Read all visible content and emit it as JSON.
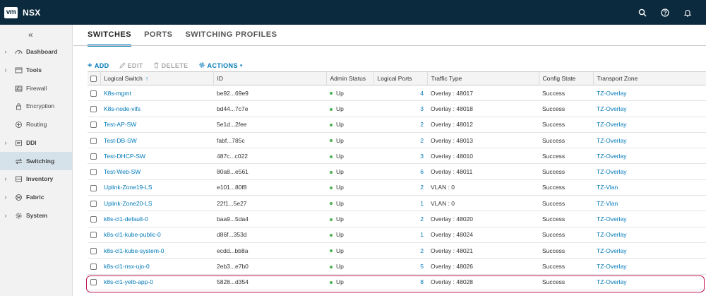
{
  "header": {
    "logo": "vm",
    "app_name": "NSX"
  },
  "sidebar": {
    "collapse_glyph": "«",
    "items": [
      {
        "label": "Dashboard",
        "icon": "dashboard-icon",
        "expandable": true
      },
      {
        "label": "Tools",
        "icon": "tools-icon",
        "expandable": true
      },
      {
        "label": "Firewall",
        "icon": "firewall-icon",
        "expandable": false
      },
      {
        "label": "Encryption",
        "icon": "lock-icon",
        "expandable": false
      },
      {
        "label": "Routing",
        "icon": "routing-icon",
        "expandable": false
      },
      {
        "label": "DDI",
        "icon": "ddi-icon",
        "expandable": true
      },
      {
        "label": "Switching",
        "icon": "switching-icon",
        "expandable": false
      },
      {
        "label": "Inventory",
        "icon": "inventory-icon",
        "expandable": true
      },
      {
        "label": "Fabric",
        "icon": "fabric-icon",
        "expandable": true
      },
      {
        "label": "System",
        "icon": "gear-icon",
        "expandable": true
      }
    ]
  },
  "tabs": [
    "SWITCHES",
    "PORTS",
    "SWITCHING PROFILES"
  ],
  "toolbar": {
    "add": "ADD",
    "edit": "EDIT",
    "delete": "DELETE",
    "actions": "ACTIONS"
  },
  "table": {
    "headers": [
      "Logical Switch",
      "ID",
      "Admin Status",
      "Logical Ports",
      "Traffic Type",
      "Config State",
      "Transport Zone"
    ],
    "rows": [
      {
        "name": "K8s-mgmt",
        "id": "be92...69e9",
        "status": "Up",
        "ports": "4",
        "traffic": "Overlay : 48017",
        "config": "Success",
        "zone": "TZ-Overlay"
      },
      {
        "name": "K8s-node-vifs",
        "id": "bd44...7c7e",
        "status": "Up",
        "ports": "3",
        "traffic": "Overlay : 48018",
        "config": "Success",
        "zone": "TZ-Overlay"
      },
      {
        "name": "Test-AP-SW",
        "id": "5e1d...2fee",
        "status": "Up",
        "ports": "2",
        "traffic": "Overlay : 48012",
        "config": "Success",
        "zone": "TZ-Overlay"
      },
      {
        "name": "Test-DB-SW",
        "id": "fabf...785c",
        "status": "Up",
        "ports": "2",
        "traffic": "Overlay : 48013",
        "config": "Success",
        "zone": "TZ-Overlay"
      },
      {
        "name": "Test-DHCP-SW",
        "id": "487c...c022",
        "status": "Up",
        "ports": "3",
        "traffic": "Overlay : 48010",
        "config": "Success",
        "zone": "TZ-Overlay"
      },
      {
        "name": "Test-Web-SW",
        "id": "80a8...e561",
        "status": "Up",
        "ports": "6",
        "traffic": "Overlay : 48011",
        "config": "Success",
        "zone": "TZ-Overlay"
      },
      {
        "name": "Uplink-Zone19-LS",
        "id": "e101...80f8",
        "status": "Up",
        "ports": "2",
        "traffic": "VLAN : 0",
        "config": "Success",
        "zone": "TZ-Vlan"
      },
      {
        "name": "Uplink-Zone20-LS",
        "id": "22f1...5e27",
        "status": "Up",
        "ports": "1",
        "traffic": "VLAN : 0",
        "config": "Success",
        "zone": "TZ-Vlan"
      },
      {
        "name": "k8s-cl1-default-0",
        "id": "baa9...5da4",
        "status": "Up",
        "ports": "2",
        "traffic": "Overlay : 48020",
        "config": "Success",
        "zone": "TZ-Overlay"
      },
      {
        "name": "k8s-cl1-kube-public-0",
        "id": "d86f...353d",
        "status": "Up",
        "ports": "1",
        "traffic": "Overlay : 48024",
        "config": "Success",
        "zone": "TZ-Overlay"
      },
      {
        "name": "k8s-cl1-kube-system-0",
        "id": "ecdd...bb8a",
        "status": "Up",
        "ports": "2",
        "traffic": "Overlay : 48021",
        "config": "Success",
        "zone": "TZ-Overlay"
      },
      {
        "name": "k8s-cl1-nsx-ujo-0",
        "id": "2eb3...e7b0",
        "status": "Up",
        "ports": "5",
        "traffic": "Overlay : 48026",
        "config": "Success",
        "zone": "TZ-Overlay"
      },
      {
        "name": "k8s-cl1-yelb-app-0",
        "id": "5828...d354",
        "status": "Up",
        "ports": "8",
        "traffic": "Overlay : 48028",
        "config": "Success",
        "zone": "TZ-Overlay"
      }
    ]
  },
  "colors": {
    "topbar": "#0c2a3e",
    "accent": "#0079b8",
    "highlight": "#c2185b",
    "status_up": "#4caf50"
  }
}
